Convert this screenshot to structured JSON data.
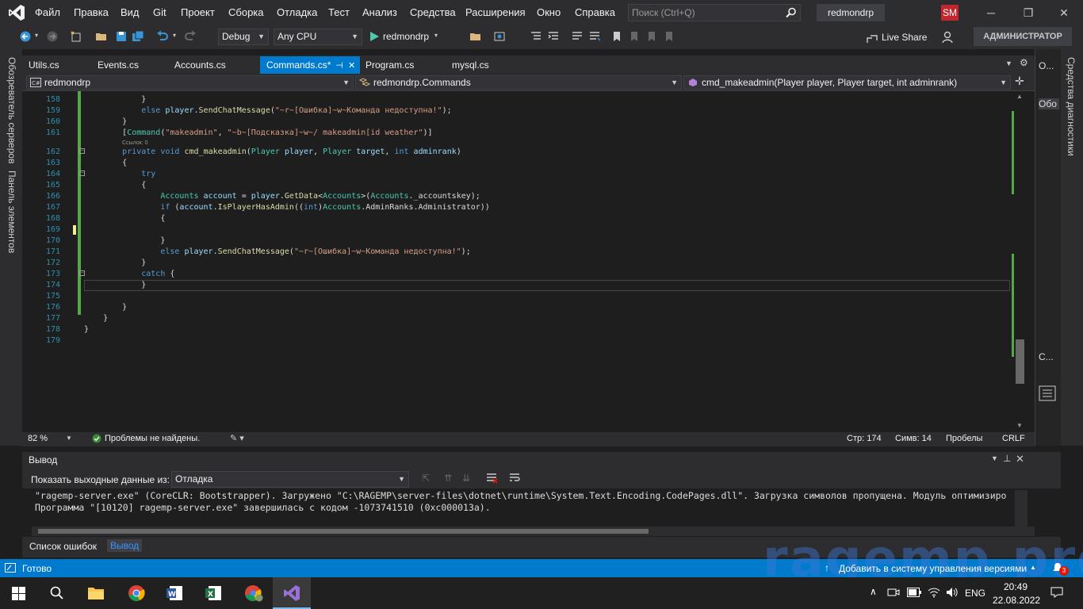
{
  "menu": {
    "items": [
      "Файл",
      "Правка",
      "Вид",
      "Git",
      "Проект",
      "Сборка",
      "Отладка",
      "Тест",
      "Анализ",
      "Средства",
      "Расширения",
      "Окно",
      "Справка"
    ],
    "search_placeholder": "Поиск (Ctrl+Q)",
    "solution_name": "redmondrp",
    "user_initials": "SM"
  },
  "toolbar": {
    "configuration": "Debug",
    "platform": "Any CPU",
    "run_target": "redmondrp",
    "live_share": "Live Share",
    "admin_badge": "АДМИНИСТРАТОР"
  },
  "side_panels": {
    "left_top": "Обозреватель серверов",
    "left_bottom": "Панель элементов",
    "right": "Средства диагностики",
    "right_panel_labels": [
      "О...",
      "Обо",
      "С..."
    ]
  },
  "tabs": [
    {
      "label": "Utils.cs"
    },
    {
      "label": "Events.cs"
    },
    {
      "label": "Accounts.cs"
    },
    {
      "label": "Commands.cs*",
      "active": true
    },
    {
      "label": "Program.cs"
    },
    {
      "label": "mysql.cs"
    }
  ],
  "navbar": {
    "project": "redmondrp",
    "class": "redmondrp.Commands",
    "member": "cmd_makeadmin(Player player, Player target, int adminrank)"
  },
  "code": {
    "refs_label": "Ссылок: 0",
    "lines": [
      {
        "n": "158",
        "text": "            }"
      },
      {
        "n": "159",
        "text": "            else player.SendChatMessage(\"~r~[Ошибка]~w~Команда недоступна!\");"
      },
      {
        "n": "160",
        "text": "        }"
      },
      {
        "n": "161",
        "text": "        [Command(\"makeadmin\", \"~b~[Подсказка]~w~/ makeadmin[id weather\")]"
      },
      {
        "n": "162",
        "text": "        private void cmd_makeadmin(Player player, Player target, int adminrank)"
      },
      {
        "n": "163",
        "text": "        {"
      },
      {
        "n": "164",
        "text": "            try"
      },
      {
        "n": "165",
        "text": "            {"
      },
      {
        "n": "166",
        "text": "                Accounts account = player.GetData<Accounts>(Accounts._accountskey);"
      },
      {
        "n": "167",
        "text": "                if (account.IsPlayerHasAdmin((int)Accounts.AdminRanks.Administrator))"
      },
      {
        "n": "168",
        "text": "                {"
      },
      {
        "n": "169",
        "text": ""
      },
      {
        "n": "170",
        "text": "                }"
      },
      {
        "n": "171",
        "text": "                else player.SendChatMessage(\"~r~[Ошибка]~w~Команда недоступна!\");"
      },
      {
        "n": "172",
        "text": "            }"
      },
      {
        "n": "173",
        "text": "            catch {"
      },
      {
        "n": "174",
        "text": "            }"
      },
      {
        "n": "175",
        "text": ""
      },
      {
        "n": "176",
        "text": "        }"
      },
      {
        "n": "177",
        "text": "    }"
      },
      {
        "n": "178",
        "text": "}"
      },
      {
        "n": "179",
        "text": ""
      }
    ]
  },
  "editor_status": {
    "zoom": "82 %",
    "problems": "Проблемы не найдены.",
    "line": "Стр: 174",
    "col": "Симв: 14",
    "whitespace": "Пробелы",
    "eol": "CRLF"
  },
  "output": {
    "title": "Вывод",
    "show_from_label": "Показать выходные данные из:",
    "show_from_value": "Отладка",
    "lines": [
      "\"ragemp-server.exe\" (CoreCLR: Bootstrapper). Загружено \"C:\\RAGEMP\\server-files\\dotnet\\runtime\\System.Text.Encoding.CodePages.dll\". Загрузка символов пропущена. Модуль оптимизиро",
      "Программа \"[10120] ragemp-server.exe\" завершилась с кодом -1073741510 (0xc000013a)."
    ],
    "bottom_tabs": [
      "Список ошибок",
      "Вывод"
    ]
  },
  "statusbar": {
    "ready": "Готово",
    "source_control": "Добавить в систему управления версиями",
    "notifications": "3"
  },
  "watermark": "ragemp.pro",
  "taskbar": {
    "apps": [
      "start-icon",
      "search-icon",
      "file-explorer-icon",
      "chrome-icon",
      "word-icon",
      "excel-icon",
      "chrome-profile-icon",
      "visual-studio-icon"
    ],
    "language": "ENG",
    "time": "20:49",
    "date": "22.08.2022"
  },
  "colors": {
    "accent": "#007acc",
    "background": "#1e1e1e",
    "chrome": "#2d2d30"
  }
}
